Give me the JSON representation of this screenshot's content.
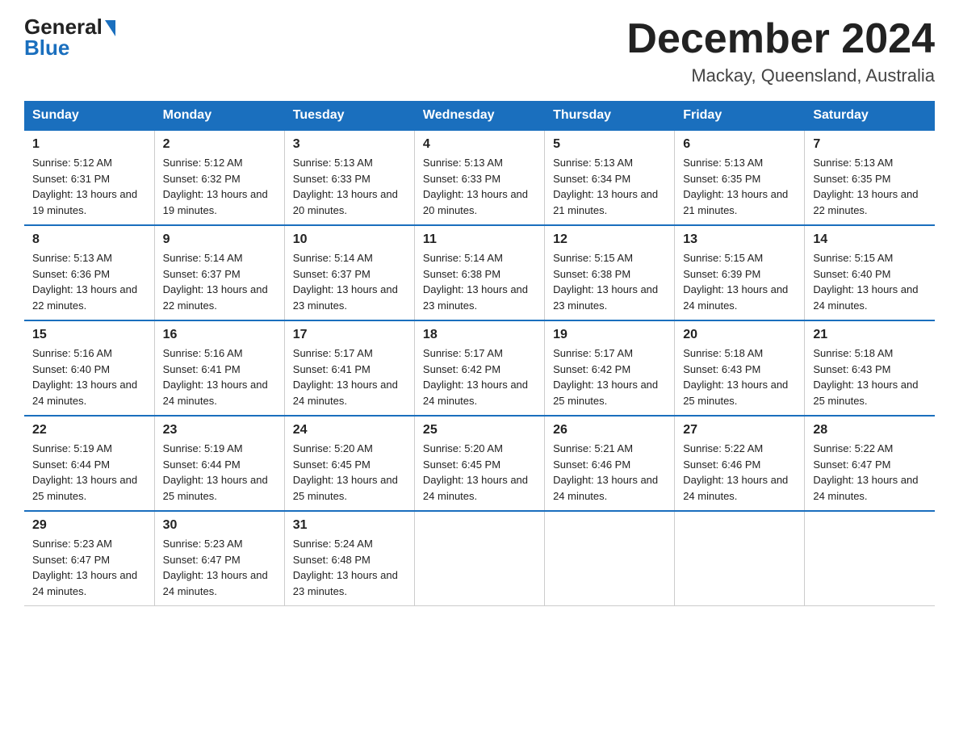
{
  "header": {
    "logo_line1": "General",
    "logo_line2": "Blue",
    "month_title": "December 2024",
    "location": "Mackay, Queensland, Australia"
  },
  "weekdays": [
    "Sunday",
    "Monday",
    "Tuesday",
    "Wednesday",
    "Thursday",
    "Friday",
    "Saturday"
  ],
  "weeks": [
    [
      {
        "num": "1",
        "sunrise": "5:12 AM",
        "sunset": "6:31 PM",
        "daylight": "13 hours and 19 minutes"
      },
      {
        "num": "2",
        "sunrise": "5:12 AM",
        "sunset": "6:32 PM",
        "daylight": "13 hours and 19 minutes"
      },
      {
        "num": "3",
        "sunrise": "5:13 AM",
        "sunset": "6:33 PM",
        "daylight": "13 hours and 20 minutes"
      },
      {
        "num": "4",
        "sunrise": "5:13 AM",
        "sunset": "6:33 PM",
        "daylight": "13 hours and 20 minutes"
      },
      {
        "num": "5",
        "sunrise": "5:13 AM",
        "sunset": "6:34 PM",
        "daylight": "13 hours and 21 minutes"
      },
      {
        "num": "6",
        "sunrise": "5:13 AM",
        "sunset": "6:35 PM",
        "daylight": "13 hours and 21 minutes"
      },
      {
        "num": "7",
        "sunrise": "5:13 AM",
        "sunset": "6:35 PM",
        "daylight": "13 hours and 22 minutes"
      }
    ],
    [
      {
        "num": "8",
        "sunrise": "5:13 AM",
        "sunset": "6:36 PM",
        "daylight": "13 hours and 22 minutes"
      },
      {
        "num": "9",
        "sunrise": "5:14 AM",
        "sunset": "6:37 PM",
        "daylight": "13 hours and 22 minutes"
      },
      {
        "num": "10",
        "sunrise": "5:14 AM",
        "sunset": "6:37 PM",
        "daylight": "13 hours and 23 minutes"
      },
      {
        "num": "11",
        "sunrise": "5:14 AM",
        "sunset": "6:38 PM",
        "daylight": "13 hours and 23 minutes"
      },
      {
        "num": "12",
        "sunrise": "5:15 AM",
        "sunset": "6:38 PM",
        "daylight": "13 hours and 23 minutes"
      },
      {
        "num": "13",
        "sunrise": "5:15 AM",
        "sunset": "6:39 PM",
        "daylight": "13 hours and 24 minutes"
      },
      {
        "num": "14",
        "sunrise": "5:15 AM",
        "sunset": "6:40 PM",
        "daylight": "13 hours and 24 minutes"
      }
    ],
    [
      {
        "num": "15",
        "sunrise": "5:16 AM",
        "sunset": "6:40 PM",
        "daylight": "13 hours and 24 minutes"
      },
      {
        "num": "16",
        "sunrise": "5:16 AM",
        "sunset": "6:41 PM",
        "daylight": "13 hours and 24 minutes"
      },
      {
        "num": "17",
        "sunrise": "5:17 AM",
        "sunset": "6:41 PM",
        "daylight": "13 hours and 24 minutes"
      },
      {
        "num": "18",
        "sunrise": "5:17 AM",
        "sunset": "6:42 PM",
        "daylight": "13 hours and 24 minutes"
      },
      {
        "num": "19",
        "sunrise": "5:17 AM",
        "sunset": "6:42 PM",
        "daylight": "13 hours and 25 minutes"
      },
      {
        "num": "20",
        "sunrise": "5:18 AM",
        "sunset": "6:43 PM",
        "daylight": "13 hours and 25 minutes"
      },
      {
        "num": "21",
        "sunrise": "5:18 AM",
        "sunset": "6:43 PM",
        "daylight": "13 hours and 25 minutes"
      }
    ],
    [
      {
        "num": "22",
        "sunrise": "5:19 AM",
        "sunset": "6:44 PM",
        "daylight": "13 hours and 25 minutes"
      },
      {
        "num": "23",
        "sunrise": "5:19 AM",
        "sunset": "6:44 PM",
        "daylight": "13 hours and 25 minutes"
      },
      {
        "num": "24",
        "sunrise": "5:20 AM",
        "sunset": "6:45 PM",
        "daylight": "13 hours and 25 minutes"
      },
      {
        "num": "25",
        "sunrise": "5:20 AM",
        "sunset": "6:45 PM",
        "daylight": "13 hours and 24 minutes"
      },
      {
        "num": "26",
        "sunrise": "5:21 AM",
        "sunset": "6:46 PM",
        "daylight": "13 hours and 24 minutes"
      },
      {
        "num": "27",
        "sunrise": "5:22 AM",
        "sunset": "6:46 PM",
        "daylight": "13 hours and 24 minutes"
      },
      {
        "num": "28",
        "sunrise": "5:22 AM",
        "sunset": "6:47 PM",
        "daylight": "13 hours and 24 minutes"
      }
    ],
    [
      {
        "num": "29",
        "sunrise": "5:23 AM",
        "sunset": "6:47 PM",
        "daylight": "13 hours and 24 minutes"
      },
      {
        "num": "30",
        "sunrise": "5:23 AM",
        "sunset": "6:47 PM",
        "daylight": "13 hours and 24 minutes"
      },
      {
        "num": "31",
        "sunrise": "5:24 AM",
        "sunset": "6:48 PM",
        "daylight": "13 hours and 23 minutes"
      },
      null,
      null,
      null,
      null
    ]
  ]
}
